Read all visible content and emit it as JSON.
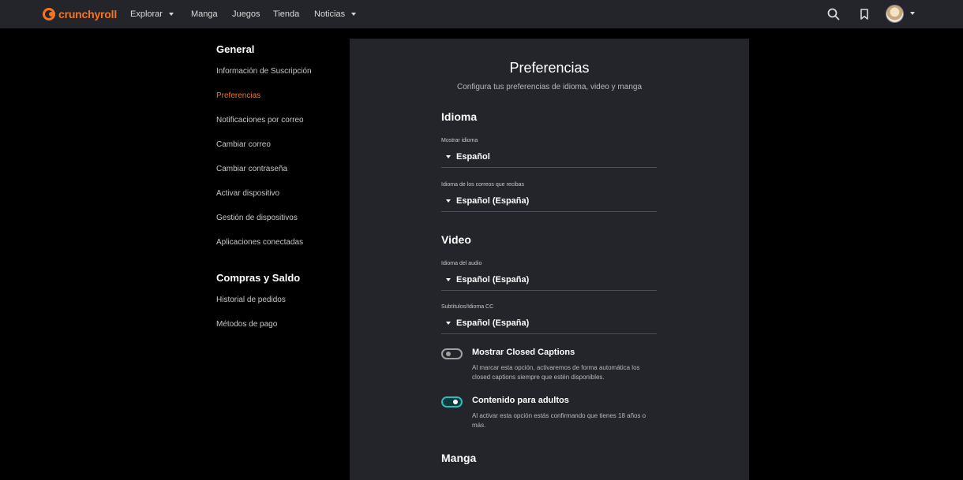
{
  "brand": {
    "name": "crunchyroll",
    "accent": "#f47521"
  },
  "nav": {
    "explorar": "Explorar",
    "manga": "Manga",
    "juegos": "Juegos",
    "tienda": "Tienda",
    "noticias": "Noticias"
  },
  "header_icons": [
    "search-icon",
    "bookmark-icon",
    "avatar",
    "chevron-down-icon"
  ],
  "sidebar": {
    "general_heading": "General",
    "general_items": [
      "Información de Suscripción",
      "Preferencias",
      "Notificaciones por correo",
      "Cambiar correo",
      "Cambiar contraseña",
      "Activar dispositivo",
      "Gestión de dispositivos",
      "Aplicaciones conectadas"
    ],
    "active_item": "Preferencias",
    "purchases_heading": "Compras y Saldo",
    "purchases_items": [
      "Historial de pedidos",
      "Métodos de pago"
    ]
  },
  "main": {
    "title": "Preferencias",
    "subtitle": "Configura tus preferencias de idioma, video y manga",
    "idioma": {
      "title": "Idioma",
      "display_label": "Mostrar idioma",
      "display_value": "Español",
      "email_label": "Idioma de los correos que recibas",
      "email_value": "Español (España)"
    },
    "video": {
      "title": "Video",
      "audio_label": "Idioma del audio",
      "audio_value": "Español (España)",
      "subs_label": "Subtítulos/Idioma CC",
      "subs_value": "Español (España)",
      "cc_title": "Mostrar Closed Captions",
      "cc_desc": "Al marcar esta opción, activaremos de forma automática los closed captions siempre que estén disponibles.",
      "cc_on": false,
      "adult_title": "Contenido para adultos",
      "adult_desc": "Al activar esta opción estás confirmando que tienes 18 años o más.",
      "adult_on": true
    },
    "manga": {
      "title": "Manga"
    }
  }
}
